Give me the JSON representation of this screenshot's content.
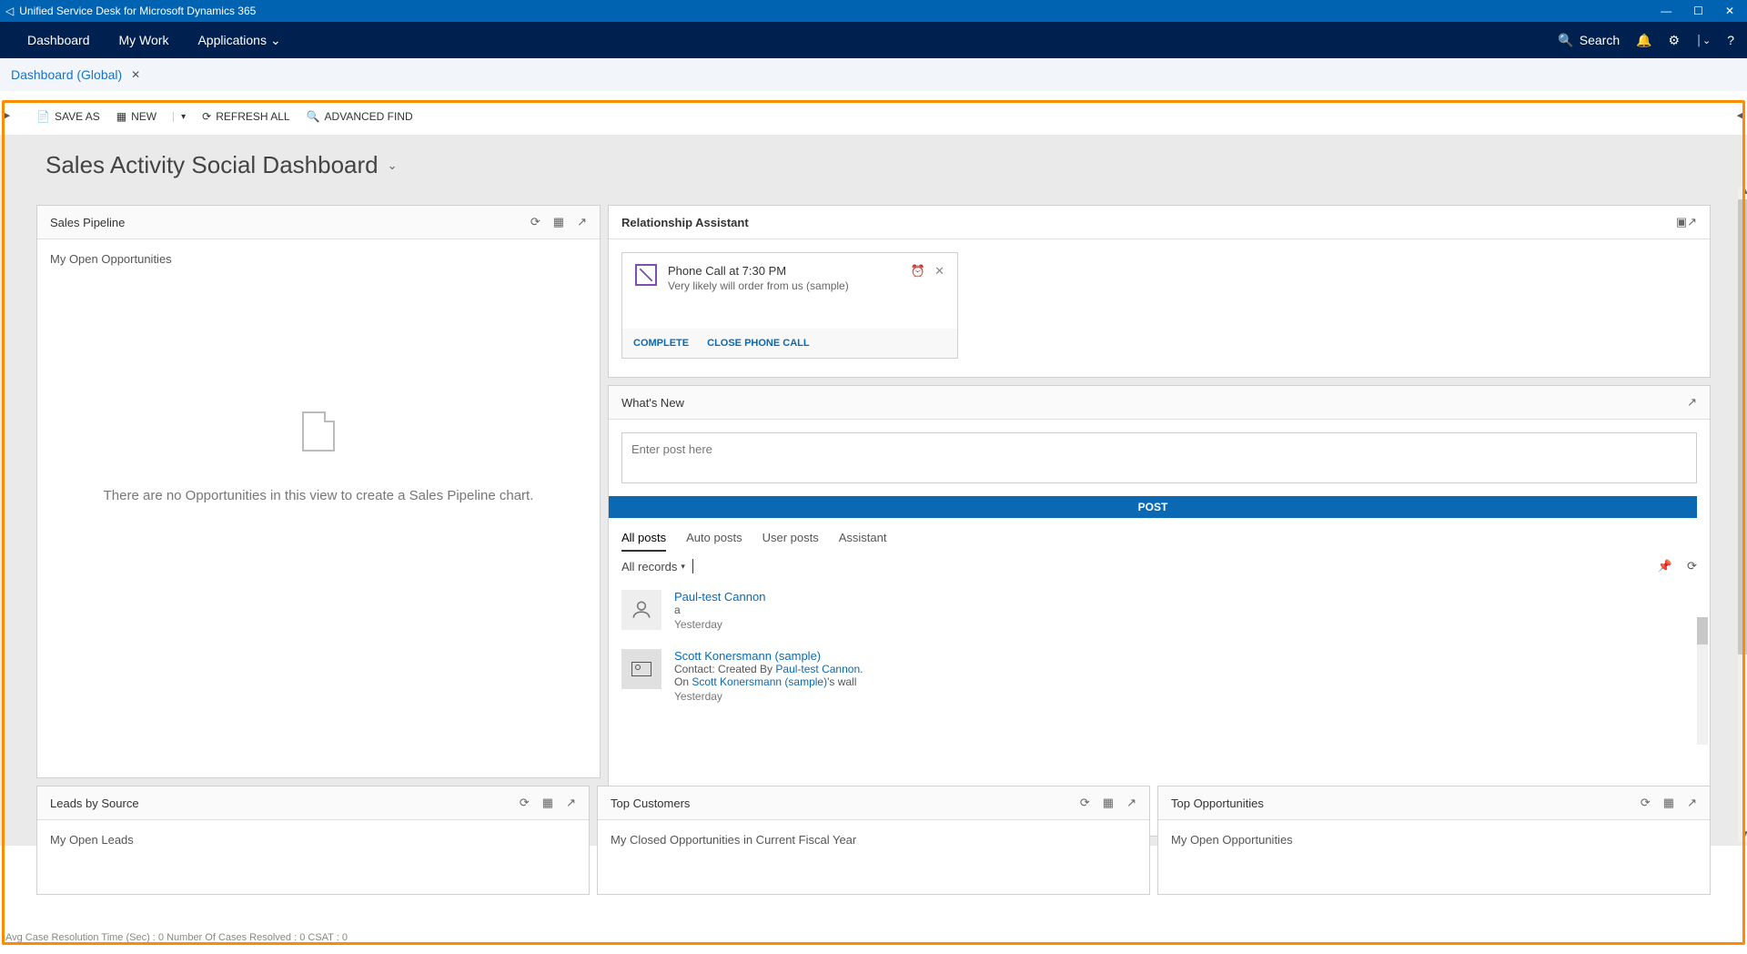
{
  "titlebar": {
    "app_name": "Unified Service Desk for Microsoft Dynamics 365"
  },
  "nav": {
    "items": [
      "Dashboard",
      "My Work",
      "Applications"
    ],
    "search_label": "Search"
  },
  "subtab": {
    "label": "Dashboard (Global)"
  },
  "toolbar": {
    "save_as": "SAVE AS",
    "new": "NEW",
    "refresh_all": "REFRESH ALL",
    "advanced_find": "ADVANCED FIND"
  },
  "dashboard_title": "Sales Activity Social Dashboard",
  "sales_pipeline": {
    "title": "Sales Pipeline",
    "subtitle": "My Open Opportunities",
    "empty_message": "There are no Opportunities in this view to create a Sales Pipeline chart."
  },
  "rel_assist": {
    "title": "Relationship Assistant",
    "card": {
      "title": "Phone Call at 7:30 PM",
      "subtitle": "Very likely will order from us (sample)",
      "action_complete": "COMPLETE",
      "action_close": "CLOSE PHONE CALL"
    }
  },
  "whats_new": {
    "title": "What's New",
    "placeholder": "Enter post here",
    "post_button": "POST",
    "tabs": [
      "All posts",
      "Auto posts",
      "User posts",
      "Assistant"
    ],
    "filter": "All records",
    "posts": [
      {
        "name": "Paul-test Cannon",
        "body": "a",
        "ts": "Yesterday"
      },
      {
        "name": "Scott Konersmann (sample)",
        "line1_pre": "Contact: Created By ",
        "line1_link": "Paul-test Cannon",
        "line1_post": ".",
        "line2_pre": "On ",
        "line2_link": "Scott Konersmann (sample)",
        "line2_post": "'s wall",
        "ts": "Yesterday"
      }
    ]
  },
  "bottom_panels": {
    "leads": {
      "title": "Leads by Source",
      "sub": "My Open Leads"
    },
    "customers": {
      "title": "Top Customers",
      "sub": "My Closed Opportunities in Current Fiscal Year"
    },
    "opportunities": {
      "title": "Top Opportunities",
      "sub": "My Open Opportunities"
    }
  },
  "status": "Avg Case Resolution Time (Sec) :   0   Number Of Cases Resolved :   0   CSAT :   0"
}
